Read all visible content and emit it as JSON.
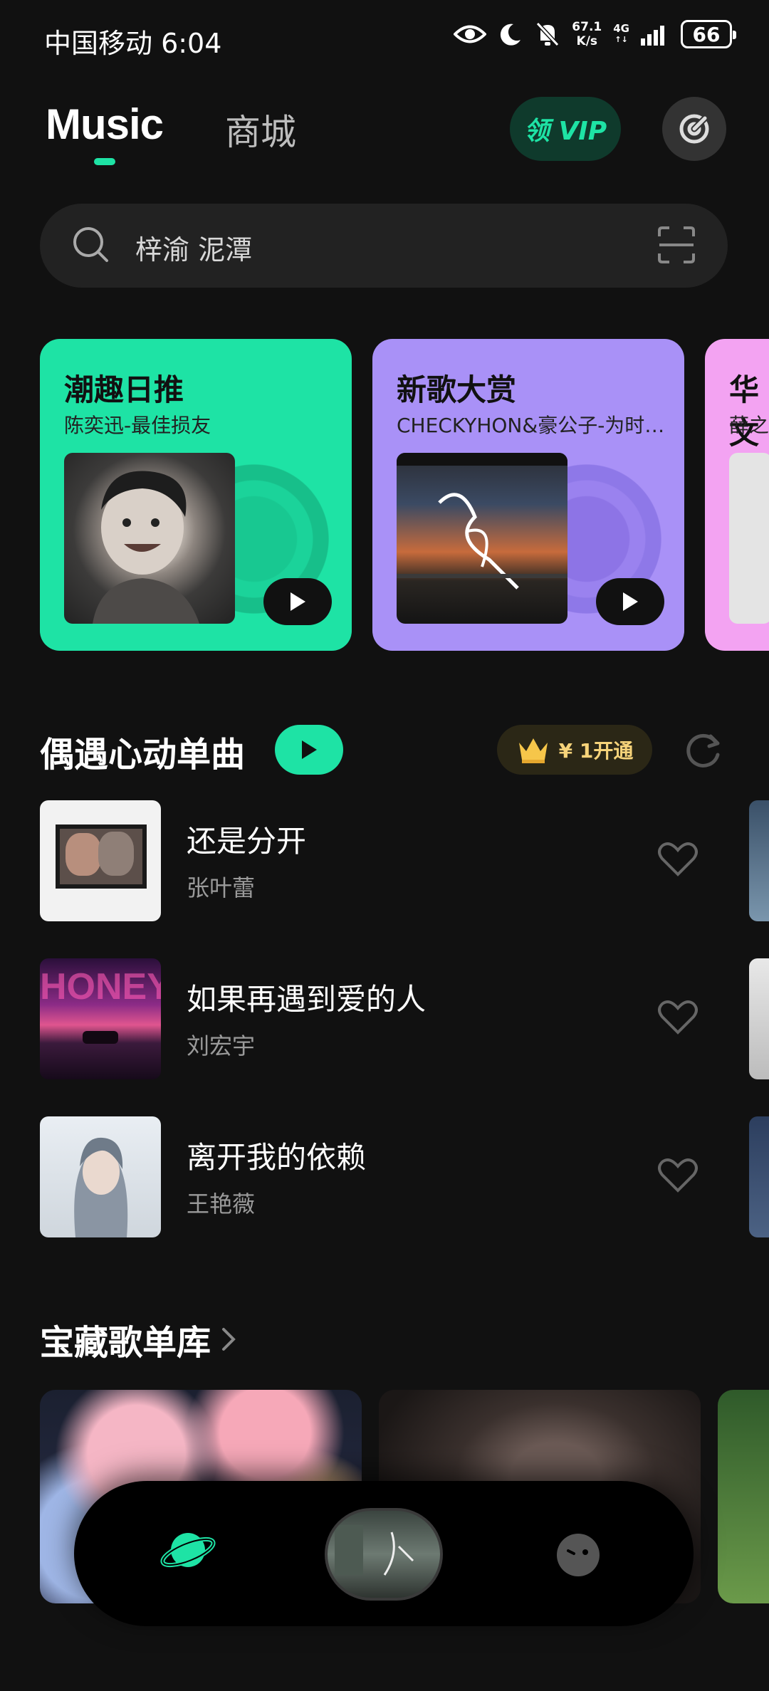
{
  "status_bar": {
    "carrier_time": "中国移动 6:04",
    "speed_value": "67.1",
    "speed_unit": "K/s",
    "network": "4G",
    "battery": "66"
  },
  "header": {
    "tab_music": "Music",
    "tab_mall": "商城",
    "vip_label": "领 VIP"
  },
  "search": {
    "placeholder": "梓渝 泥潭"
  },
  "banners": [
    {
      "title": "潮趣日推",
      "subtitle": "陈奕迅-最佳损友",
      "color": "#1ee3a5"
    },
    {
      "title": "新歌大赏",
      "subtitle": "CHECKYHON&豪公子-为时…",
      "color": "#a991f7"
    },
    {
      "title": "华文",
      "subtitle": "薛之",
      "color": "#f3a3f2"
    }
  ],
  "singles": {
    "title": "偶遇心动单曲",
    "vip_offer": "¥ 1开通",
    "songs": [
      {
        "title": "还是分开",
        "artist": "张叶蕾"
      },
      {
        "title": "如果再遇到爱的人",
        "artist": "刘宏宇"
      },
      {
        "title": "离开我的依赖",
        "artist": "王艳薇"
      }
    ]
  },
  "playlists": {
    "title": "宝藏歌单库"
  },
  "colors": {
    "accent": "#1ee3a5",
    "background": "#111111",
    "vip_gold": "#f6d37a"
  },
  "icons": {
    "eye": "eye-icon",
    "moon": "moon-icon",
    "mute": "bell-off-icon",
    "search": "search-icon",
    "scan": "scan-icon",
    "radar": "radar-icon",
    "heart": "heart-icon",
    "refresh": "refresh-icon",
    "crown": "crown-icon",
    "planet": "planet-icon",
    "face": "face-icon"
  }
}
